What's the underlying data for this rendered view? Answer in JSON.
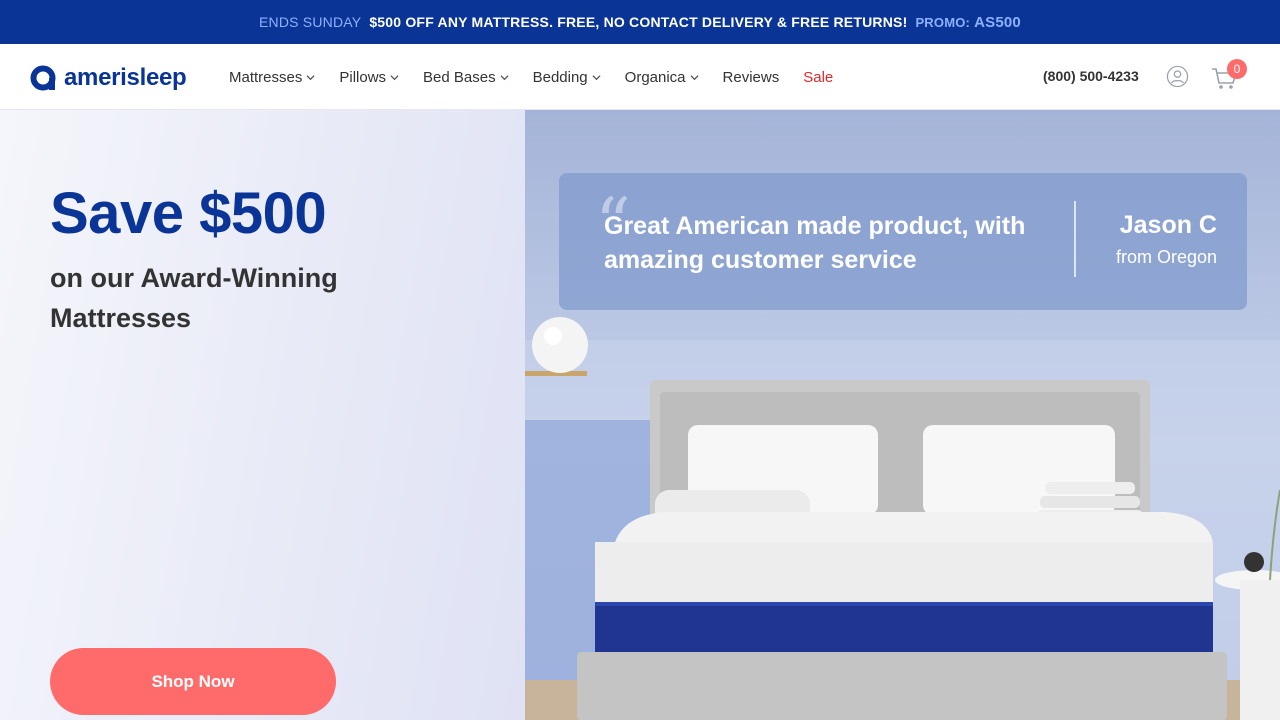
{
  "promo": {
    "ends": "ENDS SUNDAY",
    "message": "$500 OFF ANY MATTRESS. FREE, NO CONTACT DELIVERY & FREE RETURNS!",
    "code_label": "PROMO:",
    "code": "AS500"
  },
  "header": {
    "logo_text": "amerisleep",
    "nav": [
      {
        "label": "Mattresses",
        "dropdown": true
      },
      {
        "label": "Pillows",
        "dropdown": true
      },
      {
        "label": "Bed Bases",
        "dropdown": true
      },
      {
        "label": "Bedding",
        "dropdown": true
      },
      {
        "label": "Organica",
        "dropdown": true
      },
      {
        "label": "Reviews",
        "dropdown": false
      },
      {
        "label": "Sale",
        "dropdown": false
      }
    ],
    "phone": "(800) 500-4233",
    "cart_count": "0"
  },
  "hero": {
    "title": "Save $500",
    "subtitle": "on our Award-Winning Mattresses",
    "cta": "Shop Now"
  },
  "testimonial": {
    "quote": "Great American made product, with amazing customer service",
    "author": "Jason C",
    "origin": "from Oregon"
  },
  "colors": {
    "brand_blue": "#0a3597",
    "cta_coral": "#ff6b6b",
    "sale_red": "#e0282b"
  }
}
